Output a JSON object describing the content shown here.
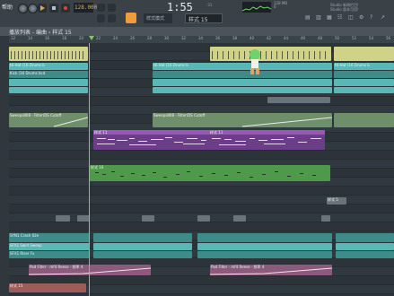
{
  "menu": {
    "label": "帮助"
  },
  "transport": {
    "tempo": "128.000",
    "time": "1:55",
    "time_small": ":31",
    "time_unit": "M:S:CS"
  },
  "toolbar": {
    "mode_label": "样式模式",
    "pattern_label": "样式 15"
  },
  "cpu": {
    "line1": "128 MB",
    "line2": "0"
  },
  "news": {
    "line1": "Studio 新闻栏目!",
    "line2": "Studio 版本可用!"
  },
  "window": {
    "title": "播放列表 - 编曲 › 样式 15"
  },
  "ruler": {
    "bars": [
      "12",
      "14",
      "16",
      "18",
      "20",
      "22",
      "24",
      "26",
      "28",
      "30",
      "32",
      "34",
      "36",
      "38",
      "40",
      "42",
      "44",
      "46",
      "48",
      "50",
      "52",
      "54",
      "56"
    ]
  },
  "clips": {
    "hh1": "Hi-Hat (16 Drums b",
    "hh2": "Hi-Hat (16 Drums b",
    "hh3": "Hi-Hat (16 Drums b",
    "kick": "Kick (16 Drums bcd",
    "auto1": "Sweeps808 - Filter/DS Cutoff",
    "auto2": "Sweeps808 - Filter/DS Cutoff",
    "pat11a": "样式 11",
    "pat11b": "样式 11",
    "pat16": "样式 16",
    "pat5": "样式 5",
    "crash": "SYN1 Crash 02e",
    "swirl": "SFX1 Swirl Sweep",
    "rise": "SFX1 Riser Fx",
    "pad1": "Pad Filter - mf4 Reese - 频率 4",
    "pad2": "Pad Filter - mf4 Reese - 频率 4",
    "pat15": "样式 15"
  }
}
